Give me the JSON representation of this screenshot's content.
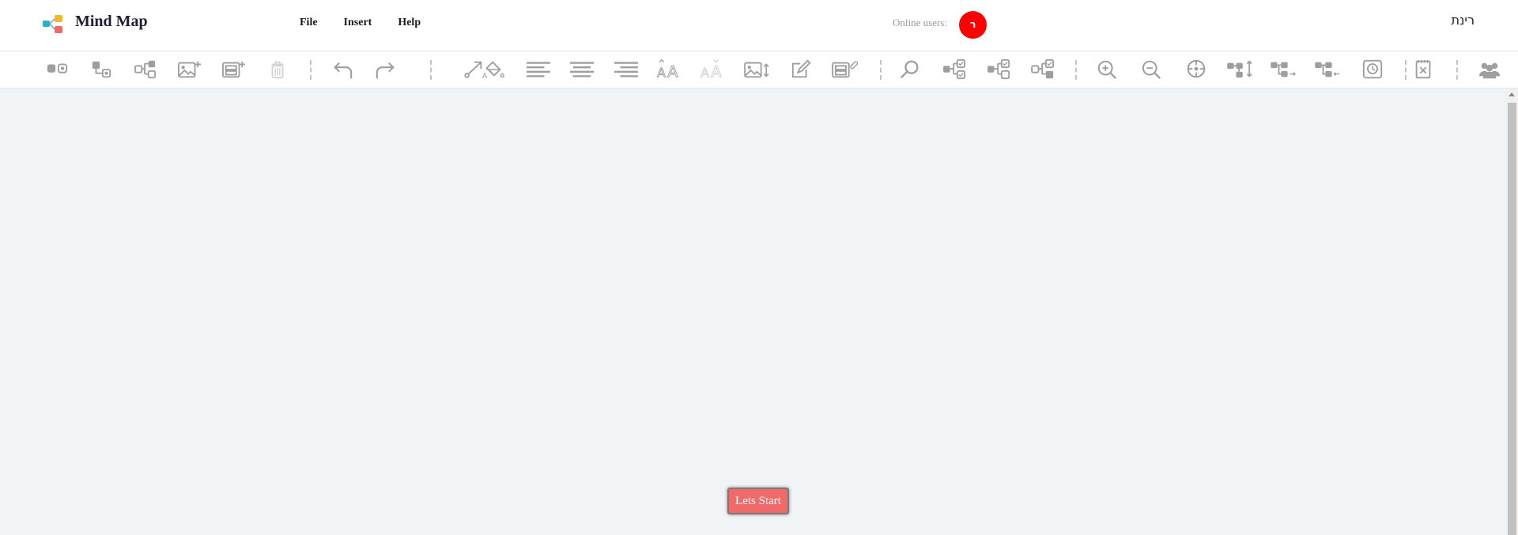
{
  "app": {
    "title": "Mind Map",
    "logo_icon": "mind-map-logo-icon"
  },
  "menu": [
    {
      "label": "File"
    },
    {
      "label": "Insert"
    },
    {
      "label": "Help"
    }
  ],
  "online": {
    "label": "Online users:",
    "avatar_initial": "ר",
    "avatar_color": "#ff0000"
  },
  "user": {
    "name": "רינת"
  },
  "toolbar": [
    {
      "icon": "add-sibling-node-icon"
    },
    {
      "icon": "add-child-node-icon"
    },
    {
      "icon": "add-parent-node-icon"
    },
    {
      "icon": "add-image-icon"
    },
    {
      "icon": "add-note-icon"
    },
    {
      "icon": "delete-icon",
      "disabled": true
    },
    {
      "separator": true
    },
    {
      "icon": "undo-icon"
    },
    {
      "icon": "redo-icon"
    },
    {
      "separator": true
    },
    {
      "icon": "arrow-connector-icon"
    },
    {
      "icon": "fill-color-icon"
    },
    {
      "icon": "align-left-icon"
    },
    {
      "icon": "align-center-icon"
    },
    {
      "icon": "align-right-icon"
    },
    {
      "icon": "font-size-increase-icon"
    },
    {
      "icon": "font-size-decrease-icon",
      "disabled": true
    },
    {
      "icon": "image-size-icon"
    },
    {
      "icon": "edit-icon"
    },
    {
      "icon": "attach-link-icon"
    },
    {
      "separator": true
    },
    {
      "icon": "search-icon"
    },
    {
      "icon": "select-siblings-icon"
    },
    {
      "icon": "select-children-icon"
    },
    {
      "icon": "select-all-icon"
    },
    {
      "separator": true
    },
    {
      "icon": "zoom-in-icon"
    },
    {
      "icon": "zoom-out-icon"
    },
    {
      "icon": "center-view-icon"
    },
    {
      "icon": "layout-vertical-icon"
    },
    {
      "icon": "layout-right-icon"
    },
    {
      "icon": "layout-left-icon"
    },
    {
      "icon": "history-icon"
    },
    {
      "separator": true
    },
    {
      "icon": "clear-map-icon"
    },
    {
      "separator": true
    },
    {
      "icon": "collaborators-icon"
    }
  ],
  "canvas": {
    "background": "#f1f4f7",
    "root_node": {
      "label": "Lets Start",
      "color": "#f06a6a"
    }
  }
}
